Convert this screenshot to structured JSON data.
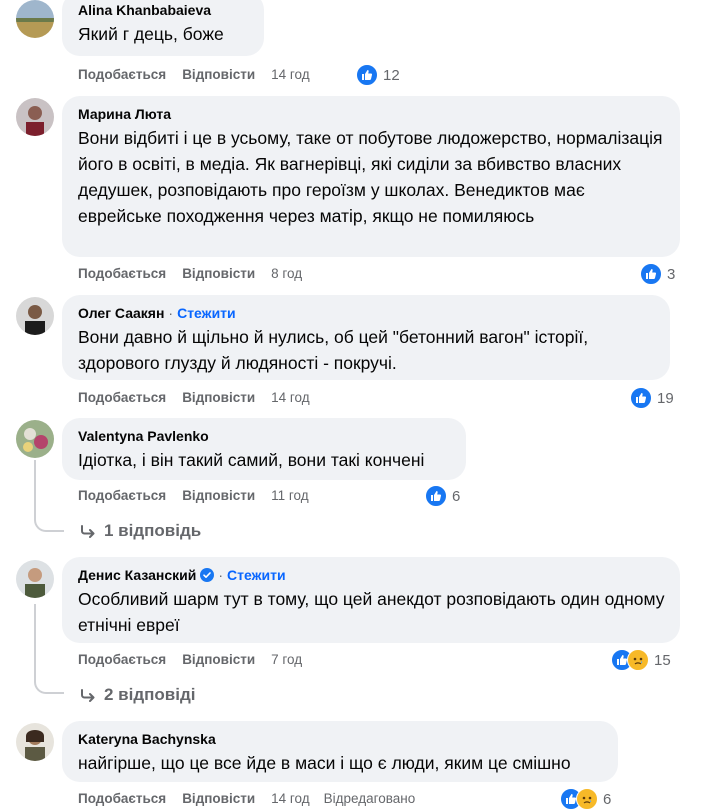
{
  "actions": {
    "like": "Подобається",
    "reply": "Відповісти",
    "edited": "Відредаговано",
    "follow": "Стежити"
  },
  "comments": [
    {
      "author": "Alina Khanbabaieva",
      "text": "Який г   дець, боже",
      "time": "14 год",
      "reactions": "12"
    },
    {
      "author": "Марина Люта",
      "text": "Вони відбиті і це в усьому, таке от побутове людожерство, нормалізація його в освіті, в медіа. Як вагнерівці, які сиділи за вбивство власних дедушек, розповідають про героїзм у школах. Венедиктов має еврейське походження через матір, якщо не помиляюсь",
      "time": "8 год",
      "reactions": "3"
    },
    {
      "author": "Олег Саакян",
      "text": "Вони давно й щільно й    нулись, об цей \"бетонний вагон\" історії, здорового глузду й людяності - покручі.",
      "time": "14 год",
      "reactions": "19"
    },
    {
      "author": "Valentyna Pavlenko",
      "text": "Ідіотка, і він такий самий, вони такі кончені",
      "time": "11 год",
      "reactions": "6",
      "replies": "1 відповідь"
    },
    {
      "author": "Денис Казанский",
      "text": "Особливий шарм тут в тому, що цей анекдот розповідають один одному етнічні евреї",
      "time": "7 год",
      "reactions": "15",
      "replies": "2 відповіді"
    },
    {
      "author": "Kateryna Bachynska",
      "text": "найгірше, що це все йде в маси і що є люди, яким це смішно",
      "time": "14 год",
      "reactions": "6"
    }
  ],
  "colors": {
    "like": "#1877f2",
    "link": "#0866ff",
    "bubble": "#f0f2f5",
    "meta": "#65676b"
  }
}
